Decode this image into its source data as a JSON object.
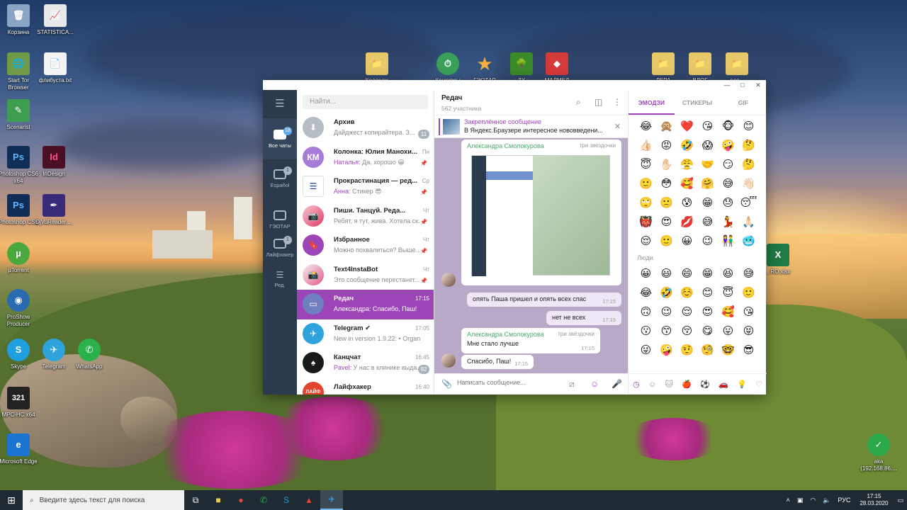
{
  "desktop": {
    "icons_left": [
      {
        "label": "Корзина",
        "icon": "recycle-bin-icon",
        "color": "#8aa4c4",
        "glyph": "🗑"
      },
      {
        "label": "STATISTICA...",
        "icon": "statistica-icon",
        "color": "#e8e8e8",
        "glyph": "📈"
      },
      {
        "label": "Start Tor Browser",
        "icon": "tor-browser-icon",
        "color": "#6f9a47",
        "glyph": "🌐"
      },
      {
        "label": "флибуста.txt",
        "icon": "text-file-icon",
        "color": "#f4f4f4",
        "glyph": "📄"
      },
      {
        "label": "Scenarist",
        "icon": "scenarist-icon",
        "color": "#3f9d4f",
        "glyph": "✎"
      },
      {
        "label": "Photoshop CS6 x64",
        "icon": "photoshop-icon",
        "color": "#0f2d55",
        "glyph": "Ps"
      },
      {
        "label": "InDesign",
        "icon": "indesign-icon",
        "color": "#4a0f22",
        "glyph": "Id"
      },
      {
        "label": "Photoshop CS6",
        "icon": "photoshop-icon",
        "color": "#0f2d55",
        "glyph": "Ps"
      },
      {
        "label": "DjVuReader....",
        "icon": "djvureader-icon",
        "color": "#3a2a7a",
        "glyph": "✒"
      },
      {
        "label": "µTorrent",
        "icon": "utorrent-icon",
        "color": "#4aa83c",
        "glyph": "µ"
      },
      {
        "label": "ProShow Producer",
        "icon": "proshow-icon",
        "color": "#2a6ab0",
        "glyph": "◉"
      },
      {
        "label": "Skype",
        "icon": "skype-icon",
        "color": "#1f9ee0",
        "glyph": "S"
      },
      {
        "label": "Telegram",
        "icon": "telegram-icon",
        "color": "#2fa3dc",
        "glyph": "✈"
      },
      {
        "label": "WhatsApp",
        "icon": "whatsapp-icon",
        "color": "#2ab14a",
        "glyph": "✆"
      },
      {
        "label": "MPC-HC x64",
        "icon": "mpc-hc-icon",
        "color": "#222222",
        "glyph": "321"
      },
      {
        "label": "Microsoft Edge",
        "icon": "edge-icon",
        "color": "#1b75d0",
        "glyph": "e"
      }
    ],
    "icons_top": [
      {
        "label": "Колледж",
        "icon": "folder-icon",
        "color": "#e8c96a",
        "glyph": "📁"
      },
      {
        "label": "Конкурсы",
        "icon": "clock-check-icon",
        "color": "#3aa05a",
        "glyph": "⏱"
      },
      {
        "label": "ГЭОТАР",
        "icon": "star-icon",
        "color": "#f3b13a",
        "glyph": "★"
      },
      {
        "label": "ДХ",
        "icon": "tree-icon",
        "color": "#3a8a2a",
        "glyph": "🌳"
      },
      {
        "label": "МАЛМЕД",
        "icon": "rubik-icon",
        "color": "#d43a3a",
        "glyph": "◆"
      },
      {
        "label": "ЛЕРА",
        "icon": "folder-icon",
        "color": "#e8c96a",
        "glyph": "📁"
      },
      {
        "label": "ВЛОГ",
        "icon": "folder-icon",
        "color": "#e8c96a",
        "glyph": "📁"
      },
      {
        "label": "для...",
        "icon": "folder-icon",
        "color": "#e8c96a",
        "glyph": "📁"
      }
    ],
    "icons_right": [
      {
        "label": "...RO.xlsx",
        "icon": "excel-icon",
        "color": "#1f7a45",
        "glyph": "X"
      },
      {
        "label": "aka (192.168.86....",
        "icon": "network-check-icon",
        "color": "#2aa84a",
        "glyph": "✓"
      }
    ]
  },
  "telegram": {
    "folders": [
      {
        "label": "Все чаты",
        "badge": "18",
        "active": true
      },
      {
        "label": "Español",
        "badge": "1"
      },
      {
        "label": "ГЭОТАР",
        "badge": ""
      },
      {
        "label": "Лайфхакер",
        "badge": "1"
      },
      {
        "label": "Ред.",
        "badge": ""
      }
    ],
    "search_placeholder": "Найти...",
    "chats": [
      {
        "name": "Архив",
        "who": "",
        "msg": "Дайджест копирайтера. З...",
        "time": "",
        "badge": "11",
        "avatar": "",
        "color": "#b5bcc4",
        "glyph": "⬇"
      },
      {
        "name": "Колонка: Юлия Манохи...",
        "who": "Наталья:",
        "msg": " Да, хорошо 😀",
        "time": "Пн",
        "badge": "",
        "avatar": "КМ",
        "color": "#a77bd8",
        "glyph": ""
      },
      {
        "name": "Прокрастинация — ред...",
        "who": "Анна:",
        "msg": " Стикер 😎",
        "time": "Ср",
        "badge": "",
        "avatar": "",
        "color": "#1b3f8e",
        "glyph": "☰"
      },
      {
        "name": "Пиши. Танцуй. Реда...",
        "who": "",
        "msg": "Ребят, я тут, жива. Хотела ск...",
        "time": "Чт",
        "badge": "",
        "avatar": "",
        "color": "#e8e8e8",
        "glyph": "📷"
      },
      {
        "name": "Избранное",
        "who": "",
        "msg": "Можно похвалиться? Выше...",
        "time": "Чт",
        "badge": "",
        "avatar": "",
        "color": "#9b45b7",
        "glyph": "🔖"
      },
      {
        "name": "Text4InstaBot",
        "who": "",
        "msg": "Это сообщение перестанет...",
        "time": "Чт",
        "badge": "",
        "avatar": "",
        "color": "#f2f2f2",
        "glyph": "📸"
      },
      {
        "name": "Редач",
        "who": "Александра:",
        "msg": " Спасибо, Паш!",
        "time": "17:15",
        "badge": "",
        "avatar": "",
        "color": "#6f7fbf",
        "glyph": "▭",
        "selected": true
      },
      {
        "name": "Telegram ✔",
        "who": "",
        "msg": "New in version 1.9.22: • Organize ...",
        "time": "17:05",
        "badge": "",
        "avatar": "",
        "color": "#2fa3dc",
        "glyph": "✈"
      },
      {
        "name": "Канцчат",
        "who": "Pavel:",
        "msg": " У нас в клинике выда...",
        "time": "16:45",
        "badge": "92",
        "avatar": "",
        "color": "#1a1a1a",
        "glyph": "♠"
      },
      {
        "name": "Лайфхакер",
        "who": "",
        "msg": "",
        "time": "16:40",
        "badge": "",
        "avatar": "ЛАЙФ",
        "color": "#e2452f",
        "glyph": ""
      }
    ],
    "chat": {
      "title": "Редач",
      "subtitle": "562 участника",
      "pinned_title": "Закреплённое сообщение",
      "pinned_text": "В Яндекс.Браузере интересное нововведени...",
      "messages": [
        {
          "author": "Александра Смолокурова",
          "role": "три звездочки",
          "text": "",
          "time": ""
        },
        {
          "author": "",
          "role": "",
          "text": "опять Паша пришел и опять всех спас",
          "time": "17:15"
        },
        {
          "author": "",
          "role": "",
          "text": "нет не всех",
          "time": "17:15"
        },
        {
          "author": "Александра Смолокурова",
          "role": "три звёздочки",
          "text": "Мне стало лучше",
          "time": "17:15"
        },
        {
          "author": "",
          "role": "",
          "text": "Спасибо, Паш!",
          "time": "17:15"
        }
      ],
      "composer_placeholder": "Написать сообщение..."
    },
    "emoji": {
      "tabs": [
        "ЭМОДЗИ",
        "СТИКЕРЫ",
        "GIF"
      ],
      "recent": [
        "😂",
        "🙊",
        "❤️",
        "😘",
        "🐵",
        "😊",
        "👍🏻",
        "😡",
        "🤣",
        "😱",
        "🤪",
        "🤔",
        "😇",
        "✋🏻",
        "😤",
        "🤝",
        "😏",
        "🤔",
        "🙂",
        "😳",
        "🥰",
        "🤗",
        "😅",
        "👋🏻",
        "🙄",
        "🙁",
        "😰",
        "😁",
        "😓",
        "😴",
        "👹",
        "😍",
        "💋",
        "😅",
        "💃",
        "🙏🏻",
        "😌",
        "🙂",
        "😀",
        "😉",
        "👫",
        "🥶"
      ],
      "section_people": "Люди",
      "people": [
        "😀",
        "😃",
        "😄",
        "😁",
        "😆",
        "😅",
        "😂",
        "🤣",
        "☺️",
        "😊",
        "😇",
        "🙂",
        "🙃",
        "😉",
        "😌",
        "😍",
        "🥰",
        "😘",
        "😗",
        "😙",
        "😚",
        "😋",
        "😛",
        "😝",
        "😜",
        "🤪",
        "🤨",
        "🧐",
        "🤓",
        "😎"
      ],
      "category_icons": [
        "clock-icon",
        "smile-icon",
        "animal-icon",
        "food-icon",
        "ball-icon",
        "car-icon",
        "bulb-icon",
        "heart-icon"
      ]
    }
  },
  "taskbar": {
    "search_placeholder": "Введите здесь текст для поиска",
    "lang": "РУС",
    "time": "17:15",
    "date": "28.03.2020"
  },
  "colors": {
    "accent": "#9b45b7",
    "folder_bar": "#2b3a4d",
    "taskbar": "#1f2a33"
  }
}
